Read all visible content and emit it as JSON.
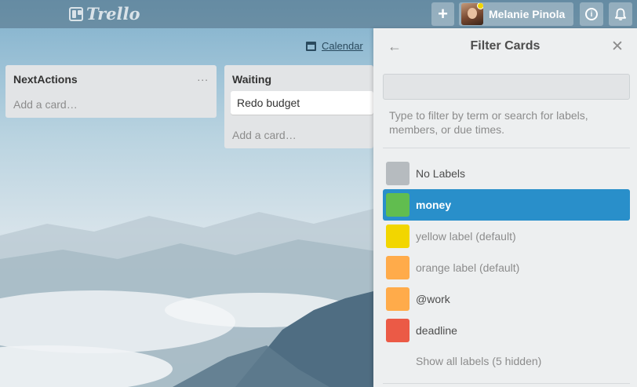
{
  "header": {
    "logo_text": "Trello",
    "add_label": "+",
    "user_name": "Melanie Pinola",
    "info_label": "i"
  },
  "board": {
    "calendar_label": "Calendar",
    "lists": [
      {
        "title": "NextActions",
        "menu_label": "...",
        "add_card_label": "Add a card…",
        "cards": []
      },
      {
        "title": "Waiting",
        "add_card_label": "Add a card…",
        "cards": [
          "Redo budget"
        ]
      }
    ]
  },
  "filter_panel": {
    "title": "Filter Cards",
    "search_value": "",
    "hint": "Type to filter by term or search for labels, members, or due times.",
    "labels": [
      {
        "name": "No Labels",
        "color": "#b6bbbf",
        "state": "normal"
      },
      {
        "name": "money",
        "color": "#61bd4f",
        "state": "active"
      },
      {
        "name": "yellow label (default)",
        "color": "#f2d600",
        "state": "default"
      },
      {
        "name": "orange label (default)",
        "color": "#ffab4a",
        "state": "default"
      },
      {
        "name": "@work",
        "color": "#ffab4a",
        "state": "normal"
      },
      {
        "name": "deadline",
        "color": "#eb5a46",
        "state": "normal"
      }
    ],
    "show_all_label": "Show all labels (5 hidden)"
  },
  "colors": {
    "active_row": "#298fca",
    "panel_bg": "#edeff0",
    "list_bg": "#e2e4e6"
  }
}
